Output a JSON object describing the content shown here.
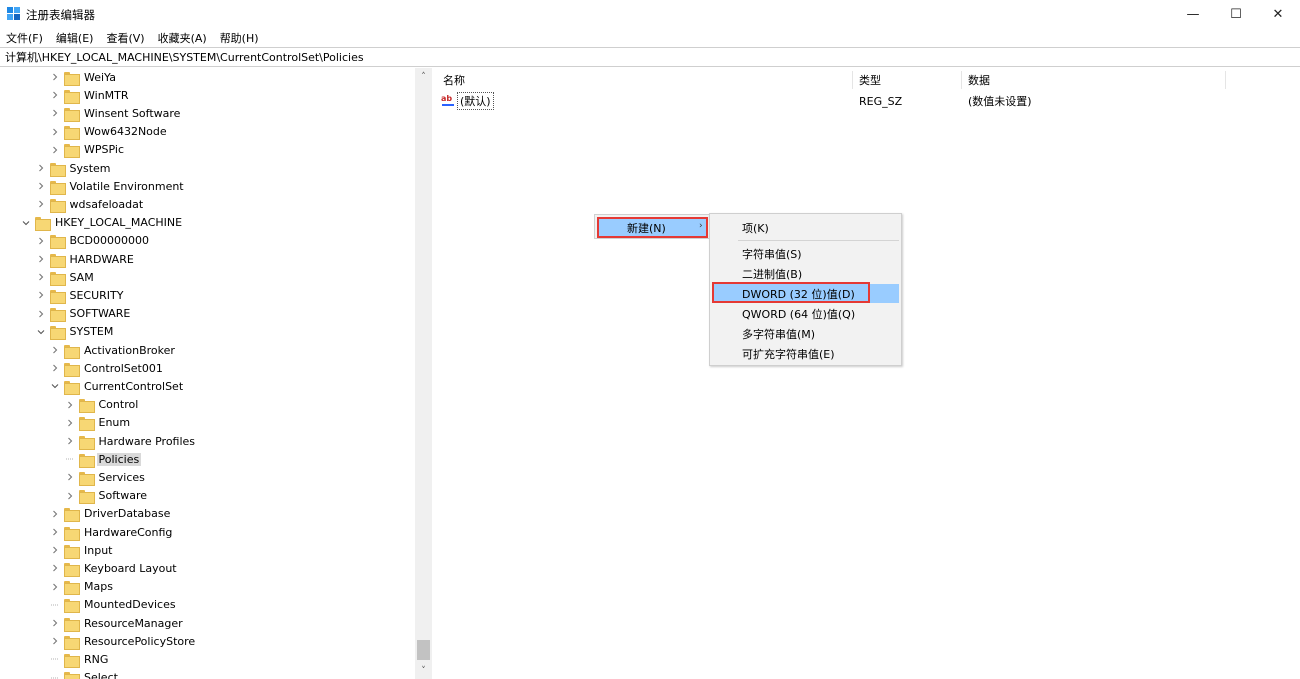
{
  "window": {
    "title": "注册表编辑器",
    "minimize_glyph": "—",
    "maximize_glyph": "☐",
    "close_glyph": "✕"
  },
  "menu": [
    "文件(F)",
    "编辑(E)",
    "查看(V)",
    "收藏夹(A)",
    "帮助(H)"
  ],
  "address": "计算机\\HKEY_LOCAL_MACHINE\\SYSTEM\\CurrentControlSet\\Policies",
  "tree": {
    "items": [
      {
        "label": "WeiYa",
        "level": 2,
        "state": "collapsed"
      },
      {
        "label": "WinMTR",
        "level": 2,
        "state": "collapsed"
      },
      {
        "label": "Winsent Software",
        "level": 2,
        "state": "collapsed"
      },
      {
        "label": "Wow6432Node",
        "level": 2,
        "state": "collapsed"
      },
      {
        "label": "WPSPic",
        "level": 2,
        "state": "collapsed"
      },
      {
        "label": "System",
        "level": 1,
        "state": "collapsed"
      },
      {
        "label": "Volatile Environment",
        "level": 1,
        "state": "collapsed"
      },
      {
        "label": "wdsafeloadat",
        "level": 1,
        "state": "collapsed"
      },
      {
        "label": "HKEY_LOCAL_MACHINE",
        "level": 0,
        "state": "expanded"
      },
      {
        "label": "BCD00000000",
        "level": 1,
        "state": "collapsed"
      },
      {
        "label": "HARDWARE",
        "level": 1,
        "state": "collapsed"
      },
      {
        "label": "SAM",
        "level": 1,
        "state": "collapsed"
      },
      {
        "label": "SECURITY",
        "level": 1,
        "state": "collapsed"
      },
      {
        "label": "SOFTWARE",
        "level": 1,
        "state": "collapsed"
      },
      {
        "label": "SYSTEM",
        "level": 1,
        "state": "expanded"
      },
      {
        "label": "ActivationBroker",
        "level": 2,
        "state": "collapsed"
      },
      {
        "label": "ControlSet001",
        "level": 2,
        "state": "collapsed"
      },
      {
        "label": "CurrentControlSet",
        "level": 2,
        "state": "expanded"
      },
      {
        "label": "Control",
        "level": 3,
        "state": "collapsed"
      },
      {
        "label": "Enum",
        "level": 3,
        "state": "collapsed"
      },
      {
        "label": "Hardware Profiles",
        "level": 3,
        "state": "collapsed"
      },
      {
        "label": "Policies",
        "level": 3,
        "state": "leaf",
        "selected": true
      },
      {
        "label": "Services",
        "level": 3,
        "state": "collapsed"
      },
      {
        "label": "Software",
        "level": 3,
        "state": "collapsed"
      },
      {
        "label": "DriverDatabase",
        "level": 2,
        "state": "collapsed"
      },
      {
        "label": "HardwareConfig",
        "level": 2,
        "state": "collapsed"
      },
      {
        "label": "Input",
        "level": 2,
        "state": "collapsed"
      },
      {
        "label": "Keyboard Layout",
        "level": 2,
        "state": "collapsed"
      },
      {
        "label": "Maps",
        "level": 2,
        "state": "collapsed"
      },
      {
        "label": "MountedDevices",
        "level": 2,
        "state": "leaf"
      },
      {
        "label": "ResourceManager",
        "level": 2,
        "state": "collapsed"
      },
      {
        "label": "ResourcePolicyStore",
        "level": 2,
        "state": "collapsed"
      },
      {
        "label": "RNG",
        "level": 2,
        "state": "leaf"
      },
      {
        "label": "Select",
        "level": 2,
        "state": "leaf"
      }
    ]
  },
  "list": {
    "columns": [
      "名称",
      "类型",
      "数据"
    ],
    "rows": [
      {
        "name": "(默认)",
        "type": "REG_SZ",
        "data": "(数值未设置)",
        "icon": "string-value-icon"
      }
    ]
  },
  "context_menu": {
    "parent_label": "新建(N)",
    "arrow_glyph": "›",
    "submenu": [
      "项(K)",
      "字符串值(S)",
      "二进制值(B)",
      "DWORD (32 位)值(D)",
      "QWORD (64 位)值(Q)",
      "多字符串值(M)",
      "可扩充字符串值(E)"
    ],
    "highlighted_index": 3
  },
  "scrollbar": {
    "up_glyph": "˄",
    "down_glyph": "˅"
  },
  "colors": {
    "menu_highlight": "#99ccff",
    "annotation_box": "#e53935",
    "folder_yellow": "#f7d774"
  }
}
